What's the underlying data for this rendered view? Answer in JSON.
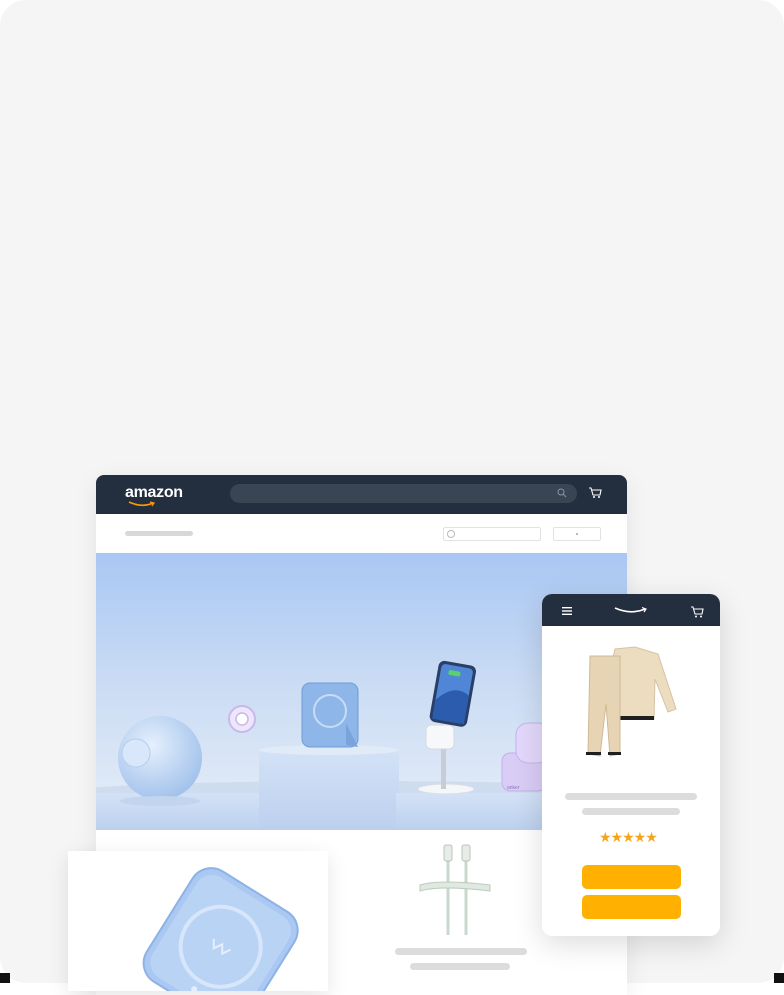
{
  "desktop": {
    "logo_text": "amazon",
    "search": {
      "placeholder": ""
    },
    "colors": {
      "header": "#232f3e",
      "hero_top": "#a9c7f3"
    }
  },
  "hero": {
    "product_labels": [
      "anker"
    ]
  },
  "mobile": {
    "rating_stars": "★★★★★",
    "rating_value": 4.5,
    "button_color": "#ffb000"
  },
  "icons": [
    "search-icon",
    "cart-icon",
    "menu-icon",
    "amazon-smile-logo"
  ]
}
